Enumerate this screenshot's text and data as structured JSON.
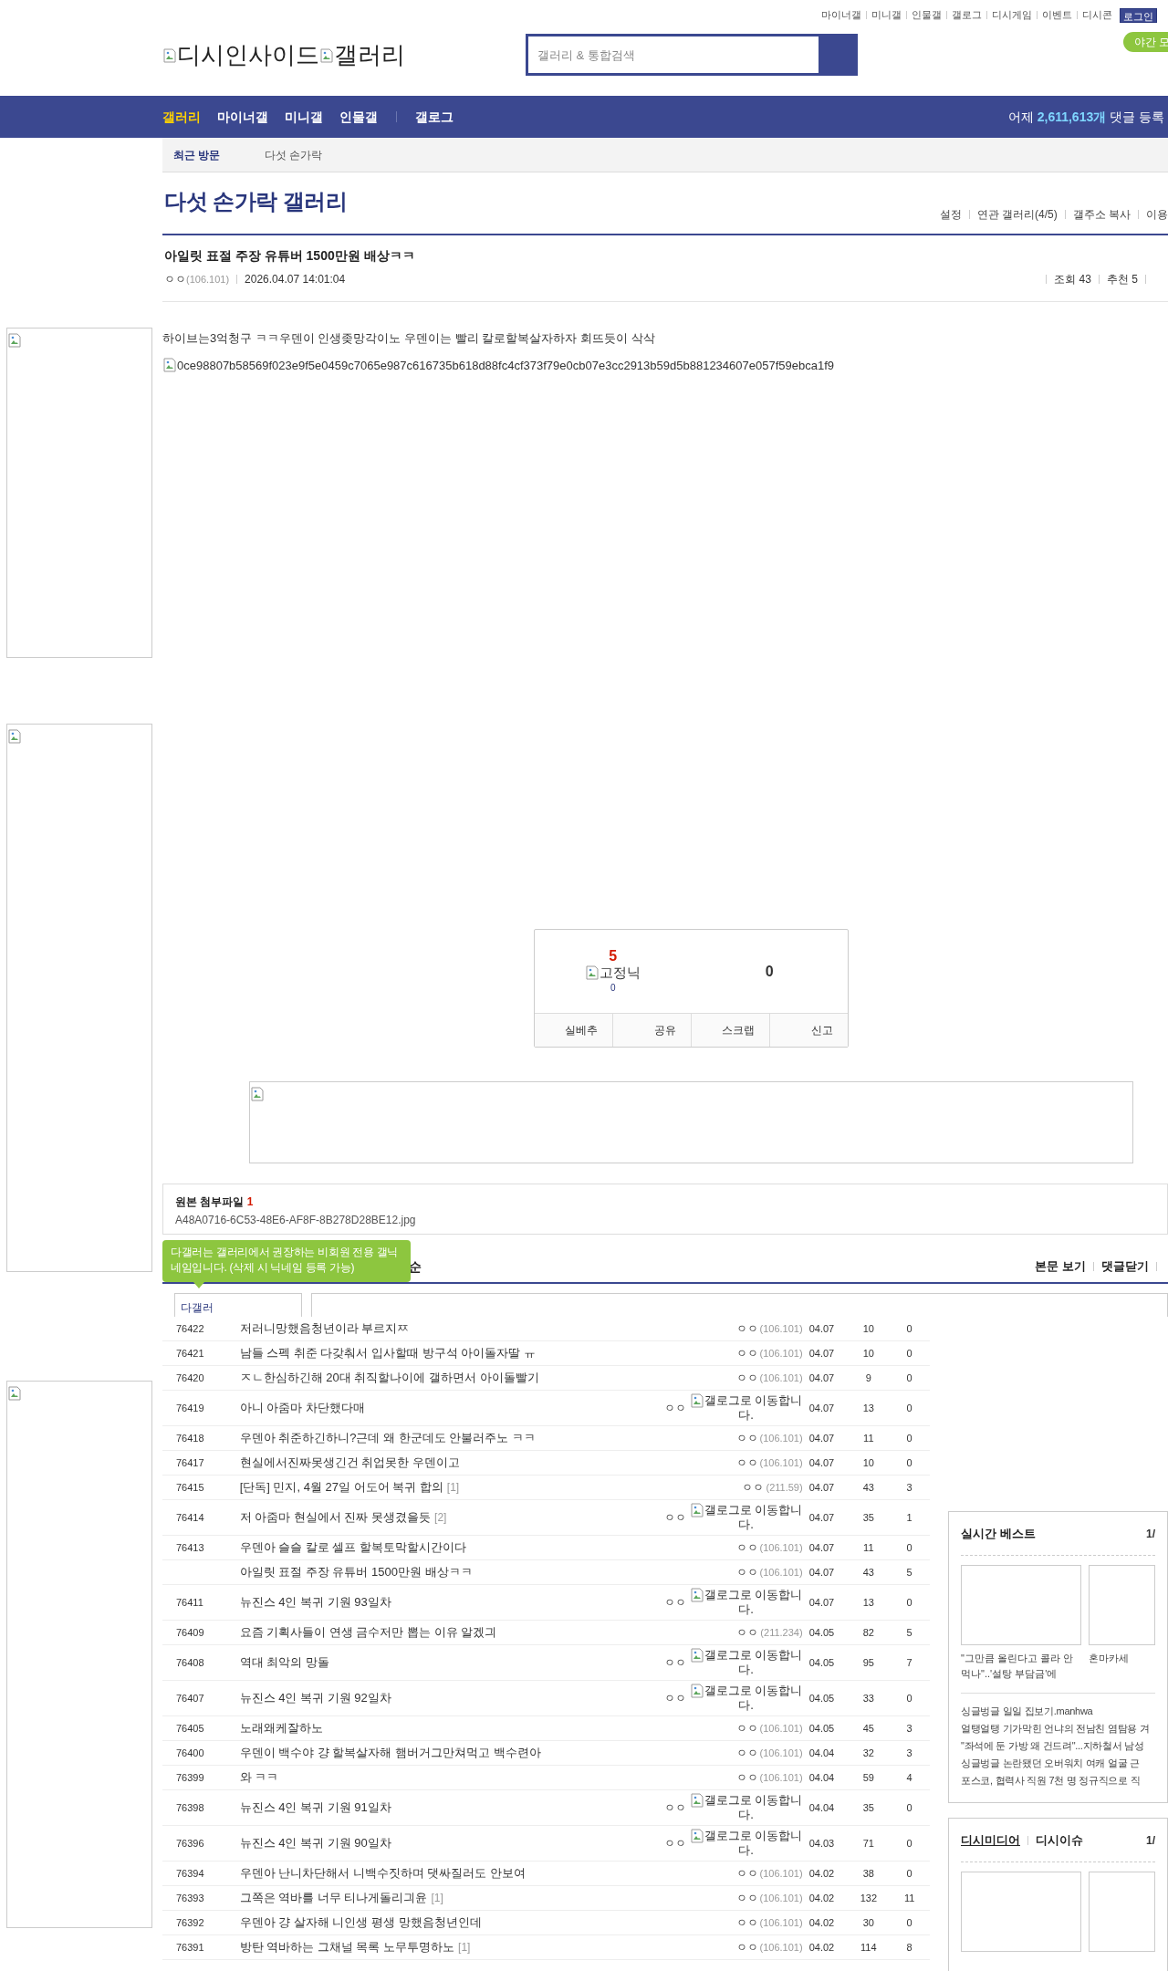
{
  "top_links": [
    "마이너갤",
    "미니갤",
    "인물갤",
    "갤로그",
    "디시게임",
    "이벤트",
    "디시콘"
  ],
  "login_button": "로그인",
  "logo": [
    "디시인사이드",
    "갤러리"
  ],
  "search": {
    "placeholder": "갤러리 & 통합검색"
  },
  "night_mode_button": "야간 모",
  "nav": {
    "groups": [
      [
        {
          "label": "갤러리",
          "selected": true
        },
        {
          "label": "마이너갤",
          "selected": false
        },
        {
          "label": "미니갤",
          "selected": false
        },
        {
          "label": "인물갤",
          "selected": false
        }
      ],
      [
        {
          "label": "갤로그",
          "selected": false
        }
      ]
    ],
    "stats": {
      "prefix": "어제",
      "count": "2,611,613개",
      "suffix": "댓글 등록"
    }
  },
  "recent": {
    "label": "최근 방문",
    "items": [
      "다섯 손가락"
    ]
  },
  "gallery": {
    "title": "다섯 손가락 갤러리",
    "links": [
      "설정",
      "연관 갤러리(4/5)",
      "갤주소 복사",
      "이용"
    ]
  },
  "post": {
    "title": "아일릿 표절 주장 유튜버 1500만원 배상ㅋㅋ",
    "author": "ㅇㅇ",
    "ip": "(106.101)",
    "date": "2026.04.07 14:01:04",
    "stats": [
      {
        "label": "조회",
        "value": "43"
      },
      {
        "label": "추천",
        "value": "5"
      }
    ],
    "body": "하이브는3억청구 ㅋㅋ우덴이 인생좆망각이노 우덴이는 빨리 칼로할복살자하자 회뜨듯이 삭삭",
    "image_alt": "0ce98807b58569f023e9f5e0459c7065e987c616735b618d88fc4cf373f79e0cb07e3cc2913b59d5b881234607e057f59ebca1f9"
  },
  "recommend": {
    "up_count": "5",
    "fixed_label": "고정닉",
    "fixed_count": "0",
    "down_count": "0",
    "buttons": [
      "실베추",
      "공유",
      "스크랩",
      "신고"
    ]
  },
  "attachment": {
    "label": "원본 첨부파일",
    "count": "1",
    "files": [
      "A48A0716-6C53-48E6-AF8F-8B278D28BE12.jpg"
    ]
  },
  "comments": {
    "heading_fragment": "순",
    "tooltip": "다갤러는 갤러리에서 권장하는 비회원 전용 갤닉네임입니다. (삭제 시 닉네임 등록 가능)",
    "actions": [
      "본문 보기",
      "댓글닫기"
    ],
    "nickname": "다갤러"
  },
  "list": [
    {
      "num": "76422",
      "title": "저러니망했음청년이라 부르지ㅉ",
      "kind": "ip",
      "writer": "ㅇㅇ",
      "ip": "(106.101)",
      "date": "04.07",
      "views": "10",
      "recs": "0"
    },
    {
      "num": "76421",
      "title": "남들 스펙 취준 다갖춰서 입사할때 방구석 아이돌자딸 ㅠ",
      "kind": "ip",
      "writer": "ㅇㅇ",
      "ip": "(106.101)",
      "date": "04.07",
      "views": "10",
      "recs": "0"
    },
    {
      "num": "76420",
      "title": "ㅈㄴ한심하긴해 20대 취직할나이에 갤하면서 아이돌빨기",
      "kind": "ip",
      "writer": "ㅇㅇ",
      "ip": "(106.101)",
      "date": "04.07",
      "views": "9",
      "recs": "0"
    },
    {
      "num": "76419",
      "title": "아니 아줌마 차단했다매",
      "kind": "gallog",
      "writer": "ㅇㅇ",
      "link_alt": "갤로그로 이동합니다.",
      "date": "04.07",
      "views": "13",
      "recs": "0"
    },
    {
      "num": "76418",
      "title": "우덴아 취준하긴하니?근데 왜 한군데도 안불러주노 ㅋㅋ",
      "kind": "ip",
      "writer": "ㅇㅇ",
      "ip": "(106.101)",
      "date": "04.07",
      "views": "11",
      "recs": "0"
    },
    {
      "num": "76417",
      "title": "현실에서진짜못생긴건 취업못한 우덴이고",
      "kind": "ip",
      "writer": "ㅇㅇ",
      "ip": "(106.101)",
      "date": "04.07",
      "views": "10",
      "recs": "0"
    },
    {
      "num": "76415",
      "title": "[단독] 민지, 4월 27일 어도어 복귀 합의",
      "reply_count": "[1]",
      "kind": "ip",
      "writer": "ㅇㅇ",
      "ip": "(211.59)",
      "date": "04.07",
      "views": "43",
      "recs": "3"
    },
    {
      "num": "76414",
      "title": "저 아줌마 현실에서 진짜 못생겼을듯",
      "reply_count": "[2]",
      "kind": "gallog",
      "writer": "ㅇㅇ",
      "link_alt": "갤로그로 이동합니다.",
      "date": "04.07",
      "views": "35",
      "recs": "1"
    },
    {
      "num": "76413",
      "title": "우덴아 슬슬 칼로 셀프 할복토막할시간이다",
      "kind": "ip",
      "writer": "ㅇㅇ",
      "ip": "(106.101)",
      "date": "04.07",
      "views": "11",
      "recs": "0"
    },
    {
      "title": "아일릿 표절 주장 유튜버 1500만원 배상ㅋㅋ",
      "kind": "ip",
      "writer": "ㅇㅇ",
      "ip": "(106.101)",
      "date": "04.07",
      "views": "43",
      "recs": "5"
    },
    {
      "num": "76411",
      "title": "뉴진스 4인 복귀 기원 93일차",
      "kind": "gallog",
      "writer": "ㅇㅇ",
      "link_alt": "갤로그로 이동합니다.",
      "date": "04.07",
      "views": "13",
      "recs": "0"
    },
    {
      "num": "76409",
      "title": "요즘 기획사들이 연생 금수저만 뽑는 이유 알겠긔",
      "kind": "ip",
      "writer": "ㅇㅇ",
      "ip": "(211.234)",
      "date": "04.05",
      "views": "82",
      "recs": "5"
    },
    {
      "num": "76408",
      "title": "역대 최악의 망돌",
      "kind": "gallog",
      "writer": "ㅇㅇ",
      "link_alt": "갤로그로 이동합니다.",
      "date": "04.05",
      "views": "95",
      "recs": "7"
    },
    {
      "num": "76407",
      "title": "뉴진스 4인 복귀 기원 92일차",
      "kind": "gallog",
      "writer": "ㅇㅇ",
      "link_alt": "갤로그로 이동합니다.",
      "date": "04.05",
      "views": "33",
      "recs": "0"
    },
    {
      "num": "76405",
      "title": "노래왜케잘하노",
      "kind": "ip",
      "writer": "ㅇㅇ",
      "ip": "(106.101)",
      "date": "04.05",
      "views": "45",
      "recs": "3"
    },
    {
      "num": "76400",
      "title": "우덴이 백수야 걍 할복살자해 햄버거그만쳐먹고 백수련아",
      "kind": "ip",
      "writer": "ㅇㅇ",
      "ip": "(106.101)",
      "date": "04.04",
      "views": "32",
      "recs": "3"
    },
    {
      "num": "76399",
      "title": "와 ㅋㅋ",
      "kind": "ip",
      "writer": "ㅇㅇ",
      "ip": "(106.101)",
      "date": "04.04",
      "views": "59",
      "recs": "4"
    },
    {
      "num": "76398",
      "title": "뉴진스 4인 복귀 기원 91일차",
      "kind": "gallog",
      "writer": "ㅇㅇ",
      "link_alt": "갤로그로 이동합니다.",
      "date": "04.04",
      "views": "35",
      "recs": "0"
    },
    {
      "num": "76396",
      "title": "뉴진스 4인 복귀 기원 90일차",
      "kind": "gallog",
      "writer": "ㅇㅇ",
      "link_alt": "갤로그로 이동합니다.",
      "date": "04.03",
      "views": "71",
      "recs": "0"
    },
    {
      "num": "76394",
      "title": "우덴아 난니차단해서 니백수짓하며 댓싸질러도 안보여",
      "kind": "ip",
      "writer": "ㅇㅇ",
      "ip": "(106.101)",
      "date": "04.02",
      "views": "38",
      "recs": "0"
    },
    {
      "num": "76393",
      "title": "그쪽은 역바를 너무 티나게돌리긔윤",
      "reply_count": "[1]",
      "kind": "ip",
      "writer": "ㅇㅇ",
      "ip": "(106.101)",
      "date": "04.02",
      "views": "132",
      "recs": "11"
    },
    {
      "num": "76392",
      "title": "우덴아 걍 살자해 니인생 평생 망했음청년인데",
      "kind": "ip",
      "writer": "ㅇㅇ",
      "ip": "(106.101)",
      "date": "04.02",
      "views": "30",
      "recs": "0"
    },
    {
      "num": "76391",
      "title": "방탄 역바하는 그채널 목록 노무투명하노",
      "reply_count": "[1]",
      "kind": "ip",
      "writer": "ㅇㅇ",
      "ip": "(106.101)",
      "date": "04.02",
      "views": "114",
      "recs": "8"
    }
  ],
  "sidebar": {
    "best": {
      "title": "실시간 베스트",
      "page": "1/",
      "cards": [
        "\"그만큼 올린다고 콜라 안 먹나\"..'설탕 부담금'에",
        "혼마카세"
      ],
      "headlines": [
        "싱글벙글 일일 집보기.manhwa",
        "얼탱얼탱 기가막힌 언냐의 전남친 염탐용 겨",
        "\"좌석에 둔 가방 왜 건드려\"...지하철서 남성",
        "싱글벙글 논란됐던 오버워치 여캐 얼굴 근",
        "포스코, 협력사 직원 7천 명 정규직으로 직"
      ]
    },
    "media": {
      "tabs": [
        {
          "label": "디시미디어",
          "selected": true
        },
        {
          "label": "디시이슈",
          "selected": false
        }
      ],
      "page": "1/"
    }
  }
}
